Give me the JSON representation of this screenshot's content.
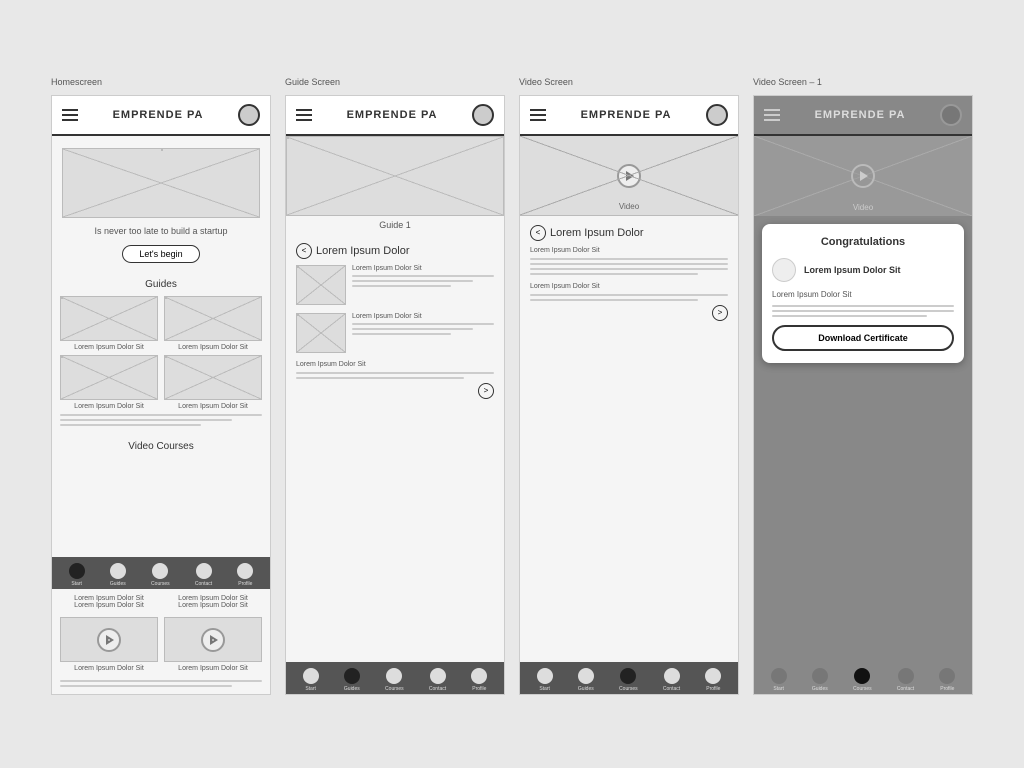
{
  "screens": [
    {
      "label": "Homescreen",
      "header": {
        "title": "EMPRENDE PA"
      },
      "hero_text": "Is never too late to build a startup",
      "lets_begin": "Let's begin",
      "guides_label": "Guides",
      "video_courses_label": "Video Courses",
      "grid_items": [
        "Lorem Ipsum Dolor Sit",
        "Lorem Ipsum Dolor Sit",
        "Lorem Ipsum Dolor Sit",
        "Lorem Ipsum Dolor Sit"
      ],
      "video_items": [
        "Lorem Ipsum Dolor Sit",
        "Lorem Ipsum Dolor Sit",
        "Lorem Ipsum Dolor Sit",
        "Lorem Ipsum Dolor Sit"
      ],
      "nav_items": [
        "Start",
        "Guides",
        "Courses",
        "Contact",
        "Profile"
      ],
      "nav_active": 0
    },
    {
      "label": "Guide Screen",
      "header": {
        "title": "EMPRENDE PA"
      },
      "hero_label": "Guide 1",
      "back_label": "Lorem Ipsum Dolor",
      "guide_items": [
        {
          "title": "Lorem Ipsum Dolor Sit",
          "lines": 3
        },
        {
          "title": "Lorem Ipsum Dolor Sit",
          "lines": 3
        }
      ],
      "footer_text": "Lorem Ipsum Dolor Sit",
      "nav_items": [
        "Start",
        "Guides",
        "Courses",
        "Contact",
        "Profile"
      ],
      "nav_active": 1
    },
    {
      "label": "Video Screen",
      "header": {
        "title": "EMPRENDE PA"
      },
      "hero_label": "Video",
      "back_label": "Lorem Ipsum Dolor",
      "content_title": "Lorem Ipsum Dolor Sit",
      "content_lines": 4,
      "footer_text": "Lorem Ipsum Dolor Sit",
      "nav_items": [
        "Start",
        "Guides",
        "Courses",
        "Contact",
        "Profile"
      ],
      "nav_active": 2
    },
    {
      "label": "Video Screen – 1",
      "header": {
        "title": "EMPRENDE PA"
      },
      "hero_label": "Video",
      "popup": {
        "title": "Congratulations",
        "user_name": "Lorem Ipsum Dolor Sit",
        "subtitle": "Lorem Ipsum Dolor Sit",
        "download_btn": "Download Certificate"
      },
      "nav_items": [
        "Start",
        "Guides",
        "Courses",
        "Contact",
        "Profile"
      ],
      "nav_active": 2
    }
  ]
}
